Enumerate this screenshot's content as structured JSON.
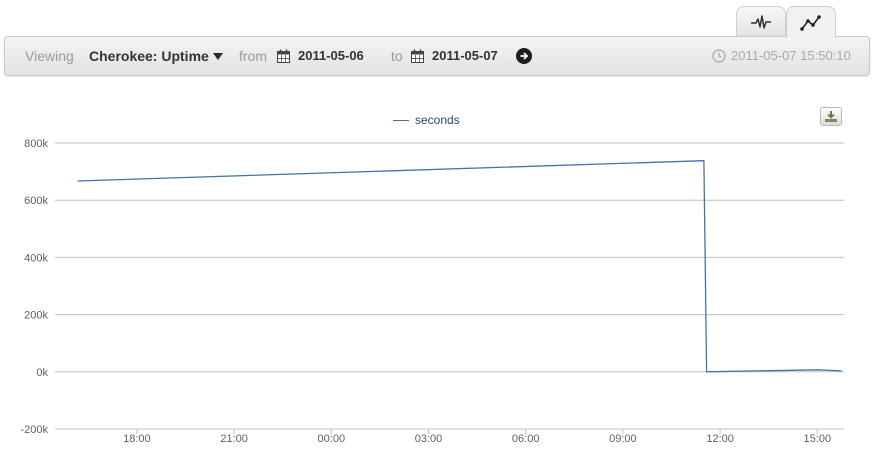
{
  "view_tabs": [
    {
      "icon": "waveform-icon",
      "active": false
    },
    {
      "icon": "line-chart-icon",
      "active": true
    }
  ],
  "toolbar": {
    "viewing_label": "Viewing",
    "metric": "Cherokee: Uptime",
    "from_label": "from",
    "from_date": "2011-05-06",
    "to_label": "to",
    "to_date": "2011-05-07",
    "timestamp": "2011-05-07 15:50:10"
  },
  "colors": {
    "series": "#4572a7",
    "grid": "#c0c0c0",
    "axis_text": "#606060",
    "legend_text": "#274b6d"
  },
  "chart_data": {
    "type": "line",
    "legend_position": "top-center",
    "series": [
      {
        "name": "seconds",
        "x": [
          "2011-05-06 16:10",
          "2011-05-07 11:30",
          "2011-05-07 11:35",
          "2011-05-07 15:00",
          "2011-05-07 15:45"
        ],
        "y": [
          667000,
          738000,
          0,
          7000,
          3000
        ]
      }
    ],
    "y_ticks": [
      "-200k",
      "0k",
      "200k",
      "400k",
      "600k",
      "800k"
    ],
    "ylim": [
      -200000,
      800000
    ],
    "x_ticks": [
      "18:00",
      "21:00",
      "00:00",
      "03:00",
      "06:00",
      "09:00",
      "12:00",
      "15:00"
    ],
    "grid": true
  }
}
